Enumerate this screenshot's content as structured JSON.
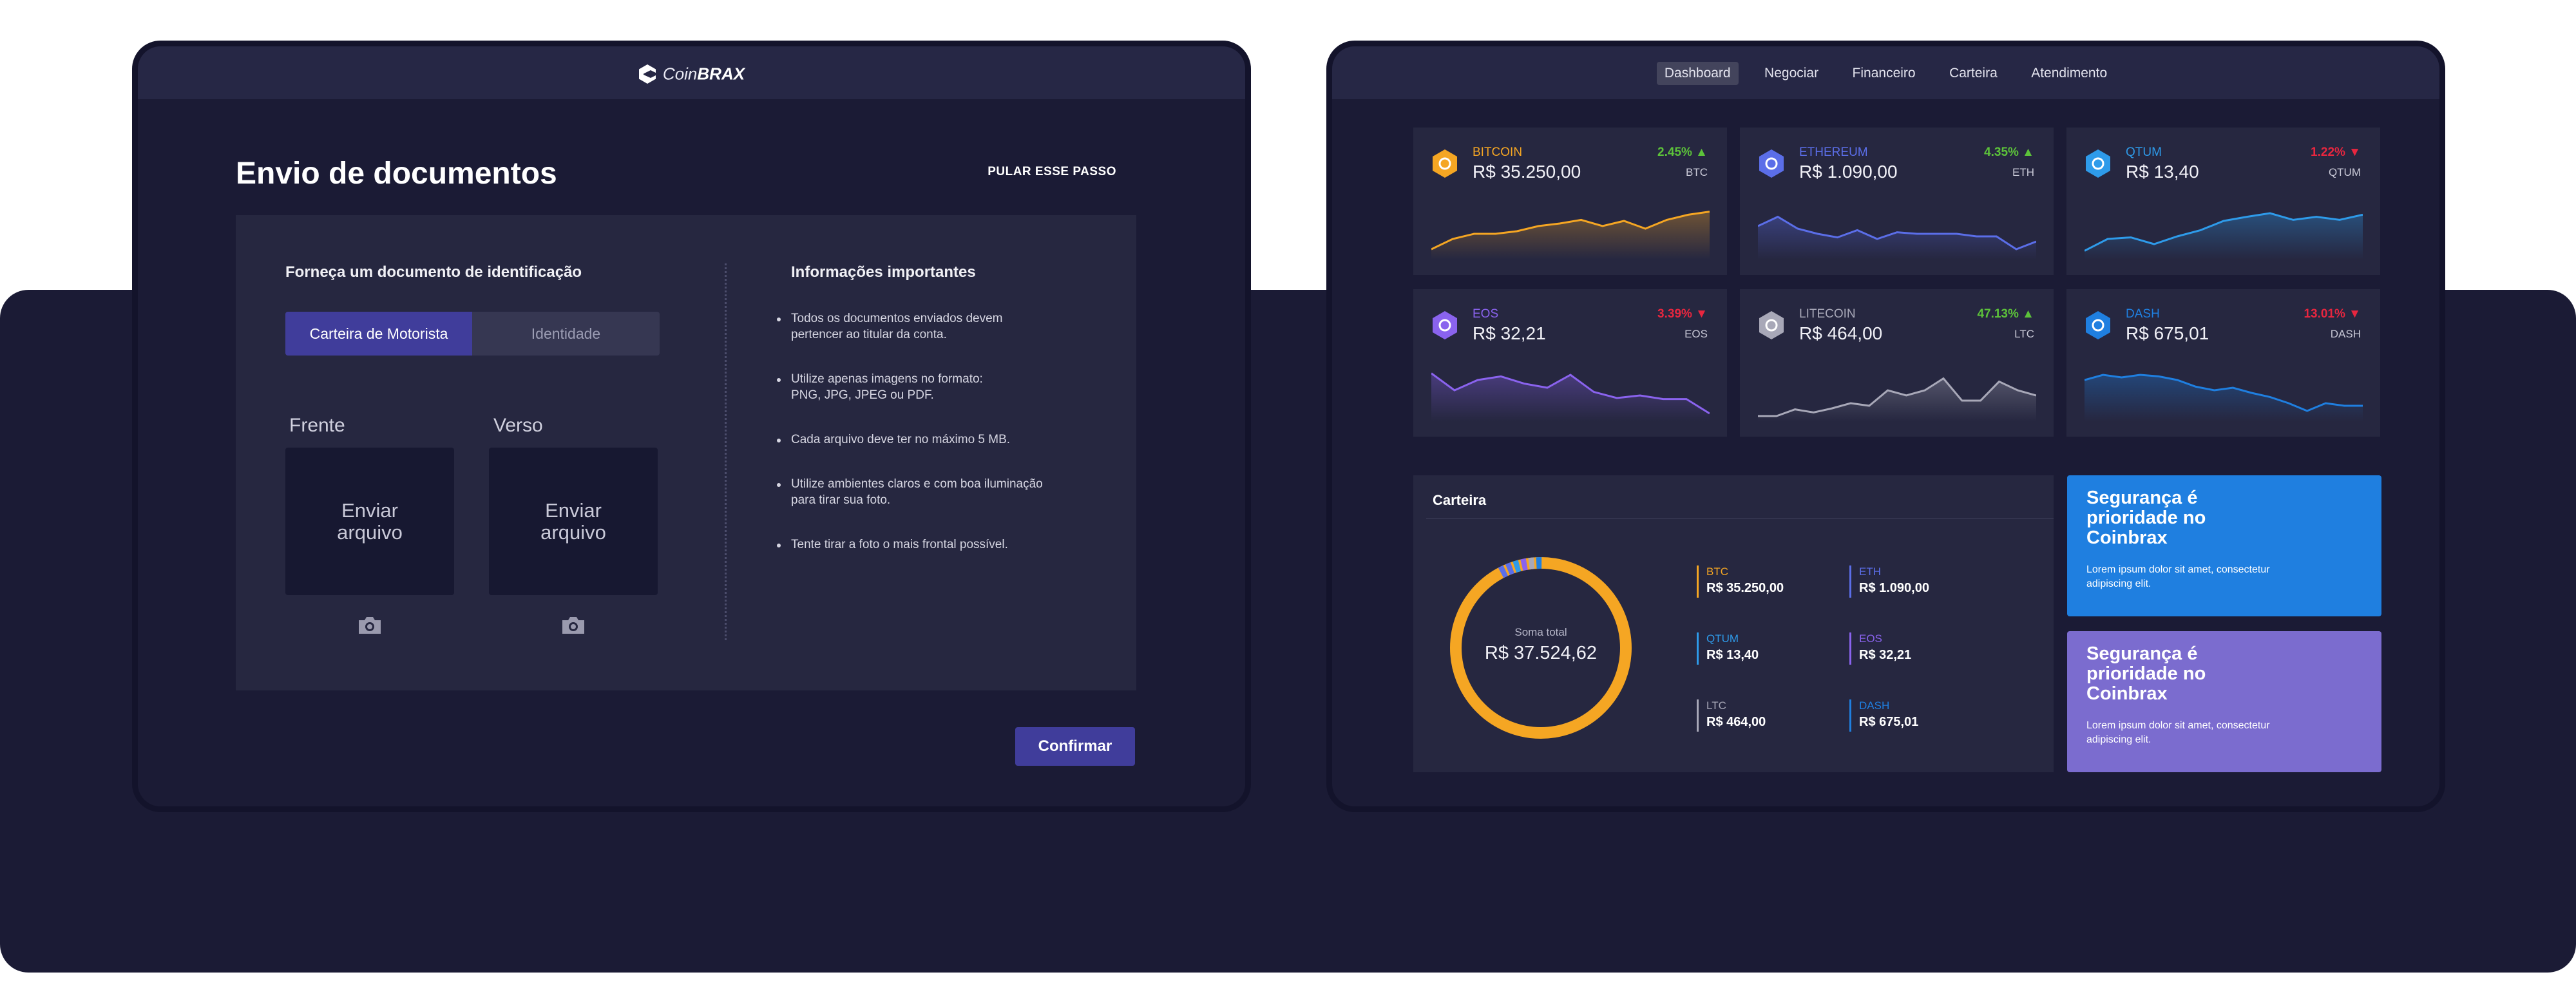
{
  "left": {
    "logo": {
      "part1": "Coin",
      "part2": "BRAX"
    },
    "title": "Envio de documentos",
    "skip_label": "PULAR ESSE PASSO",
    "doc_section_title": "Forneça um documento de identificação",
    "doc_types": [
      "Carteira de Motorista",
      "Identidade"
    ],
    "selected_doc_type": "Carteira de Motorista",
    "front_label": "Frente",
    "back_label": "Verso",
    "upload_label": "Enviar\narquivo",
    "info_title": "Informações importantes",
    "info_items": [
      "Todos os documentos enviados devem\npertencer ao titular da conta.",
      "Utilize apenas imagens no formato:\nPNG, JPG, JPEG ou PDF.",
      "Cada arquivo deve ter no máximo 5 MB.",
      "Utilize ambientes claros e com boa iluminação\npara tirar sua foto.",
      "Tente tirar a foto o mais frontal possível."
    ],
    "confirm_label": "Confirmar"
  },
  "right": {
    "nav": [
      "Dashboard",
      "Negociar",
      "Financeiro",
      "Carteira",
      "Atendimento"
    ],
    "active_nav": "Dashboard",
    "coins": [
      {
        "name": "BITCOIN",
        "price": "R$ 35.250,00",
        "change": "2.45%",
        "direction": "up",
        "symbol": "BTC",
        "color": "#f5a623",
        "icon": "bitcoin-icon",
        "spark": [
          0.15,
          0.35,
          0.45,
          0.45,
          0.5,
          0.6,
          0.65,
          0.72,
          0.6,
          0.7,
          0.55,
          0.72,
          0.82,
          0.88
        ]
      },
      {
        "name": "ETHEREUM",
        "price": "R$ 1.090,00",
        "change": "4.35%",
        "direction": "up",
        "symbol": "ETH",
        "color": "#5b6ee8",
        "icon": "ethereum-icon",
        "spark": [
          0.6,
          0.78,
          0.55,
          0.45,
          0.38,
          0.52,
          0.35,
          0.48,
          0.45,
          0.45,
          0.45,
          0.4,
          0.4,
          0.15,
          0.3
        ]
      },
      {
        "name": "QTUM",
        "price": "R$ 13,40",
        "change": "1.22%",
        "direction": "down",
        "symbol": "QTUM",
        "color": "#2e9bea",
        "icon": "qtum-icon",
        "spark": [
          0.12,
          0.35,
          0.38,
          0.25,
          0.4,
          0.52,
          0.7,
          0.78,
          0.85,
          0.72,
          0.78,
          0.72,
          0.82
        ]
      },
      {
        "name": "EOS",
        "price": "R$ 32,21",
        "change": "3.39%",
        "direction": "down",
        "symbol": "EOS",
        "color": "#8a63ee",
        "icon": "eos-icon",
        "spark": [
          0.88,
          0.55,
          0.75,
          0.82,
          0.68,
          0.6,
          0.85,
          0.52,
          0.4,
          0.45,
          0.38,
          0.38,
          0.1
        ]
      },
      {
        "name": "LITECOIN",
        "price": "R$ 464,00",
        "change": "47.13%",
        "direction": "up",
        "symbol": "LTC",
        "color": "#a8a8b8",
        "icon": "litecoin-icon",
        "spark": [
          0.05,
          0.05,
          0.18,
          0.12,
          0.2,
          0.3,
          0.25,
          0.55,
          0.45,
          0.55,
          0.78,
          0.35,
          0.35,
          0.72,
          0.55,
          0.45
        ]
      },
      {
        "name": "DASH",
        "price": "R$ 675,01",
        "change": "13.01%",
        "direction": "down",
        "symbol": "DASH",
        "color": "#1f7fe0",
        "icon": "dash-icon",
        "spark": [
          0.75,
          0.85,
          0.8,
          0.85,
          0.82,
          0.75,
          0.62,
          0.55,
          0.6,
          0.5,
          0.42,
          0.3,
          0.15,
          0.3,
          0.25,
          0.25
        ]
      }
    ],
    "wallet": {
      "title": "Carteira",
      "total_label": "Soma total",
      "total_value": "R$ 37.524,62",
      "items": [
        {
          "symbol": "BTC",
          "value": "R$ 35.250,00",
          "color": "#f5a623"
        },
        {
          "symbol": "ETH",
          "value": "R$ 1.090,00",
          "color": "#5b6ee8"
        },
        {
          "symbol": "QTUM",
          "value": "R$ 13,40",
          "color": "#2e9bea"
        },
        {
          "symbol": "EOS",
          "value": "R$ 32,21",
          "color": "#8a63ee"
        },
        {
          "symbol": "LTC",
          "value": "R$ 464,00",
          "color": "#a8a8b8"
        },
        {
          "symbol": "DASH",
          "value": "R$ 675,01",
          "color": "#1f7fe0"
        }
      ]
    },
    "promos": [
      {
        "title": "Segurança é prioridade no Coinbrax",
        "text": "Lorem ipsum dolor sit amet, consectetur adipiscing elit.",
        "color": "#1f7fe0"
      },
      {
        "title": "Segurança é prioridade no Coinbrax",
        "text": "Lorem ipsum dolor sit amet, consectetur adipiscing elit.",
        "color": "#7b6ccf"
      }
    ]
  }
}
